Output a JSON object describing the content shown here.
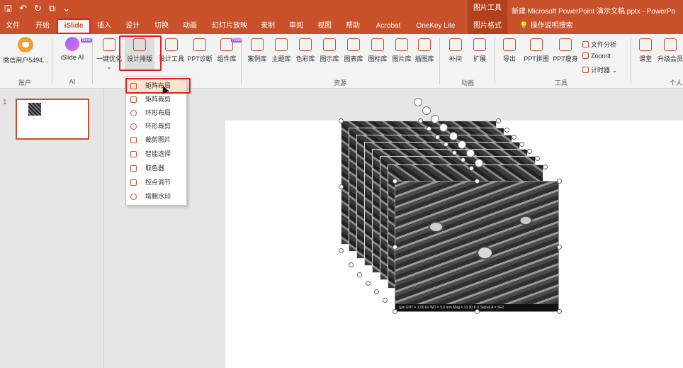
{
  "titlebar": {
    "picture_tools": "图片工具",
    "doc_title": "新建 Microsoft PowerPoint 演示文稿.pptx  -  PowerPo"
  },
  "qat_icons": [
    "save-icon",
    "undo-icon",
    "redo-icon",
    "format-icon",
    "customize-icon"
  ],
  "tabs": [
    "文件",
    "开始",
    "iSlide",
    "插入",
    "设计",
    "切换",
    "动画",
    "幻灯片放映",
    "录制",
    "审阅",
    "视图",
    "帮助",
    "Acrobat",
    "OneKey Lite",
    "图片格式",
    "操作说明搜索"
  ],
  "ribbon": {
    "account": {
      "user": "微信用户5494...",
      "group": "账户"
    },
    "ai": {
      "label": "iSlide AI",
      "group": "AI",
      "badge": "New"
    },
    "design": {
      "one_click": "一键优化",
      "design_layout": "设计排版",
      "design_tools": "设计工具",
      "ppt_diagnose": "PPT诊断",
      "component_lib": "组件库",
      "badge": "New"
    },
    "resources": {
      "items": [
        "案例库",
        "主题库",
        "色彩库",
        "图示库",
        "图表库",
        "图标库",
        "图片库",
        "插图库"
      ],
      "group": "资源"
    },
    "animation": {
      "items": [
        "补间",
        "扩展"
      ],
      "group": "动画"
    },
    "tools": {
      "items": [
        "导出",
        "PPT拼图",
        "PPT瘦身"
      ],
      "small": [
        "文件分析",
        "ZoomIt",
        "计时器"
      ],
      "group": "工具"
    },
    "personal": {
      "items": [
        "课堂",
        "升级会员"
      ],
      "group": "个人"
    }
  },
  "dropdown": {
    "items": [
      "矩阵布局",
      "矩阵裁剪",
      "环形布局",
      "环形裁剪",
      "裁剪图片",
      "智能选择",
      "取色器",
      "控点调节",
      "增删水印"
    ]
  },
  "slides": {
    "number": "1"
  },
  "image_caption": "1µm      EHT = 1.00 kV     WD = 5.0 mm     Mag = 10.00 K X     Signal A = SE2"
}
